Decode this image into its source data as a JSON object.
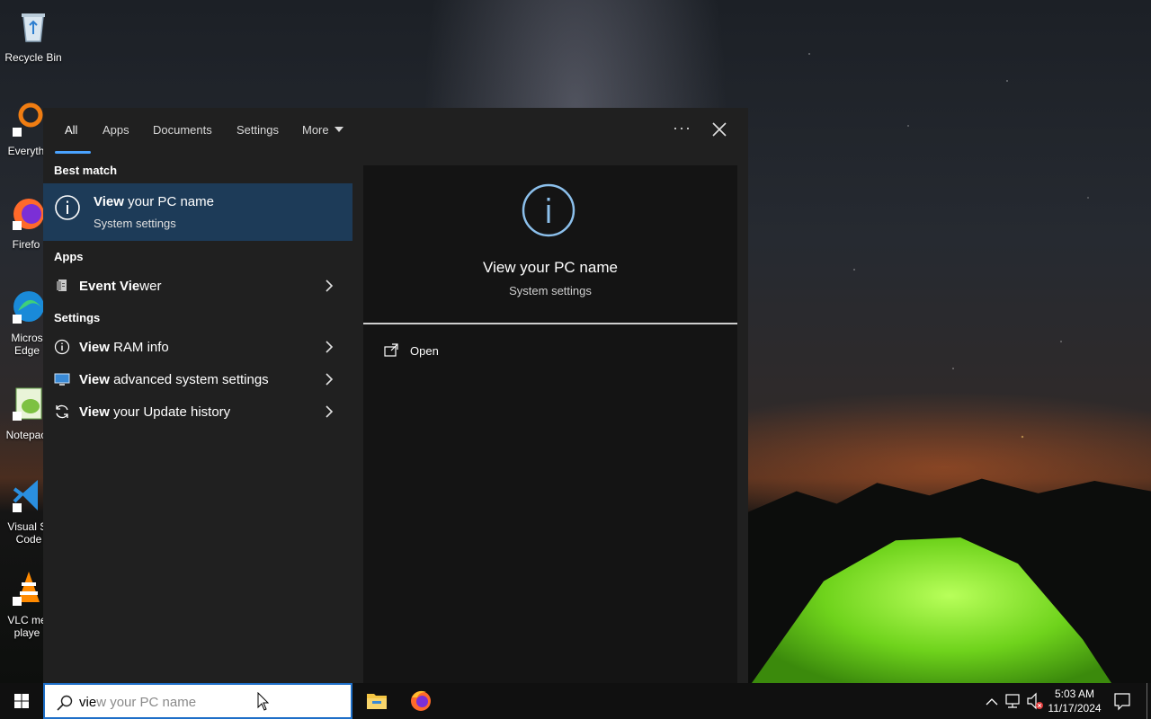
{
  "desktop": {
    "icons": [
      {
        "label": "Recycle Bin"
      },
      {
        "label": "Everyth"
      },
      {
        "label": "Firefo"
      },
      {
        "label": "Micros Edge"
      },
      {
        "label": "Notepac"
      },
      {
        "label": "Visual St Code"
      },
      {
        "label": "VLC me playe"
      }
    ]
  },
  "search_panel": {
    "tabs": [
      {
        "label": "All",
        "active": true
      },
      {
        "label": "Apps"
      },
      {
        "label": "Documents"
      },
      {
        "label": "Settings"
      },
      {
        "label": "More"
      }
    ],
    "more_options_label": "···",
    "best_match": {
      "heading": "Best match",
      "title_bold": "View",
      "title_rest": " your PC name",
      "subtitle": "System settings",
      "icon": "info-icon"
    },
    "apps_section": {
      "heading": "Apps",
      "items": [
        {
          "bold": "Event Vie",
          "rest": "wer",
          "icon": "event-viewer-icon"
        }
      ]
    },
    "settings_section": {
      "heading": "Settings",
      "items": [
        {
          "bold": "View",
          "rest": " RAM info",
          "icon": "info-icon"
        },
        {
          "bold": "View",
          "rest": " advanced system settings",
          "icon": "monitor-icon"
        },
        {
          "bold": "View",
          "rest": " your Update history",
          "icon": "refresh-icon"
        }
      ]
    },
    "preview": {
      "title": "View your PC name",
      "subtitle": "System settings",
      "action_open": "Open"
    }
  },
  "taskbar": {
    "search_typed": "vie",
    "search_ghost": "w your PC name",
    "clock_time": "5:03 AM",
    "clock_date": "11/17/2024"
  },
  "colors": {
    "accent": "#4aa3ff",
    "selected_row": "#1d3b58",
    "panel_bg": "#202020",
    "preview_bg": "#141414"
  }
}
